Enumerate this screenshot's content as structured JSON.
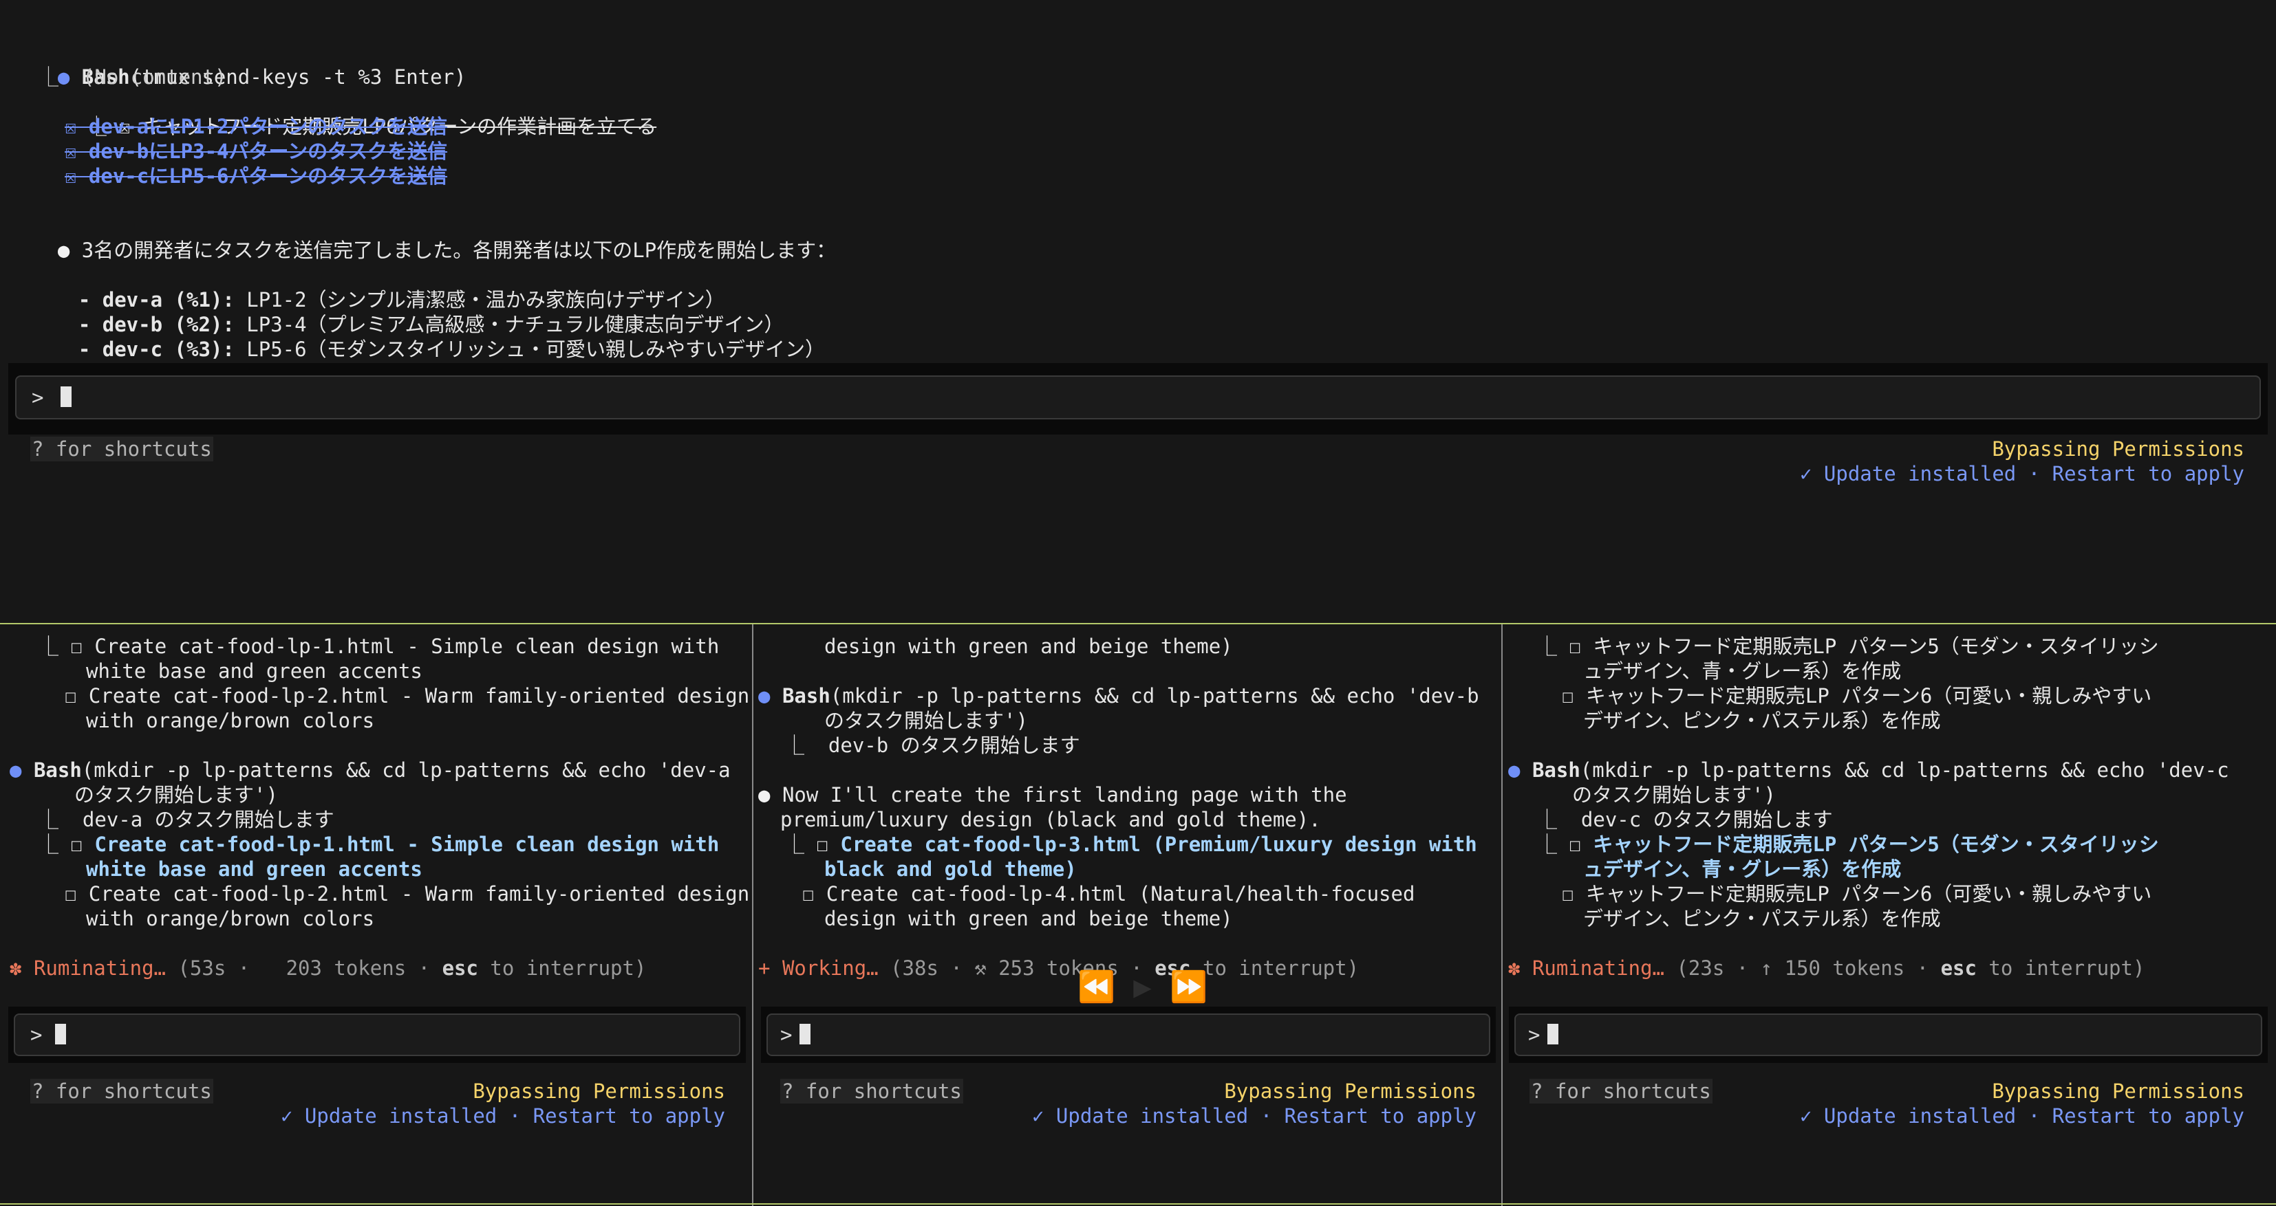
{
  "common": {
    "prompt": ">",
    "shortcuts_hint": "? for shortcuts",
    "bypass": "Bypassing Permissions",
    "update": "✓ Update installed · Restart to apply"
  },
  "top": {
    "bash_label": "Bash",
    "bash_cmd": "(tmux send-keys -t %3 Enter)",
    "no_content": "⎿  (No content)",
    "todo_prefix": "⎿ ☒ ",
    "todo_main": "キャットフード定期販売LP6パターンの作業計画を立てる",
    "done_items": [
      "☒ dev-aにLP1-2パターンのタスクを送信",
      "☒ dev-bにLP3-4パターンのタスクを送信",
      "☒ dev-cにLP5-6パターンのタスクを送信"
    ],
    "summary": "3名の開発者にタスクを送信完了しました。各開発者は以下のLP作成を開始します：",
    "devs": [
      {
        "label": "- dev-a (%1):",
        "text": " LP1-2（シンプル清潔感・温かみ家族向けデザイン）"
      },
      {
        "label": "- dev-b (%2):",
        "text": " LP3-4（プレミアム高級感・ナチュラル健康志向デザイン）"
      },
      {
        "label": "- dev-c (%3):",
        "text": " LP5-6（モダンスタイリッシュ・可愛い親しみやすいデザイン）"
      }
    ]
  },
  "pane_a": {
    "l1_prefix": "⎿ ☐ ",
    "l1": "Create cat-food-lp-1.html - Simple clean design with",
    "l2": "white base and green accents",
    "l3": "☐ Create cat-food-lp-2.html - Warm family-oriented design",
    "l4": "with orange/brown colors",
    "bash_label": "Bash",
    "bash_cmd": "(mkdir -p lp-patterns && cd lp-patterns && echo 'dev-a",
    "bash_cmd2": "のタスク開始します')",
    "out": "⎿  dev-a のタスク開始します",
    "cur_prefix": "⎿ ☐ ",
    "cur1": "Create cat-food-lp-1.html - Simple clean design with",
    "cur2": "white base and green accents",
    "n1": "☐ Create cat-food-lp-2.html - Warm family-oriented design",
    "n2": "with orange/brown colors",
    "status_icon": "✽",
    "status_word": "Ruminating…",
    "status_rest": " (53s ·   203 tokens · ",
    "esc": "esc",
    "interrupt": " to interrupt)"
  },
  "pane_b": {
    "l1": "design with green and beige theme)",
    "bash_label": "Bash",
    "bash_cmd": "(mkdir -p lp-patterns && cd lp-patterns && echo 'dev-b",
    "bash_cmd2": "のタスク開始します')",
    "out": "⎿  dev-b のタスク開始します",
    "msg1": "Now I'll create the first landing page with the",
    "msg2": "premium/luxury design (black and gold theme).",
    "cur_prefix": "⎿ ☐ ",
    "cur1": "Create cat-food-lp-3.html (Premium/luxury design with",
    "cur2": "black and gold theme)",
    "n1": "☐ Create cat-food-lp-4.html (Natural/health-focused",
    "n2": "design with green and beige theme)",
    "status_icon": "+",
    "status_word": "Working…",
    "status_rest": " (38s · ⚒ 253 tokens · ",
    "esc": "esc",
    "interrupt": " to interrupt)"
  },
  "pane_c": {
    "l1_prefix": "⎿ ☐ ",
    "l1": "キャットフード定期販売LP パターン5（モダン・スタイリッシ",
    "l2": "ュデザイン、青・グレー系）を作成",
    "l3": "☐ キャットフード定期販売LP パターン6（可愛い・親しみやすい",
    "l4": "デザイン、ピンク・パステル系）を作成",
    "bash_label": "Bash",
    "bash_cmd": "(mkdir -p lp-patterns && cd lp-patterns && echo 'dev-c",
    "bash_cmd2": "のタスク開始します')",
    "out": "⎿  dev-c のタスク開始します",
    "cur_prefix": "⎿ ☐ ",
    "cur1": "キャットフード定期販売LP パターン5（モダン・スタイリッシ",
    "cur2": "ュデザイン、青・グレー系）を作成",
    "n1": "☐ キャットフード定期販売LP パターン6（可愛い・親しみやすい",
    "n2": "デザイン、ピンク・パステル系）を作成",
    "status_icon": "✽",
    "status_word": "Ruminating…",
    "status_rest": " (23s · ↑ 150 tokens · ",
    "esc": "esc",
    "interrupt": " to interrupt)"
  }
}
